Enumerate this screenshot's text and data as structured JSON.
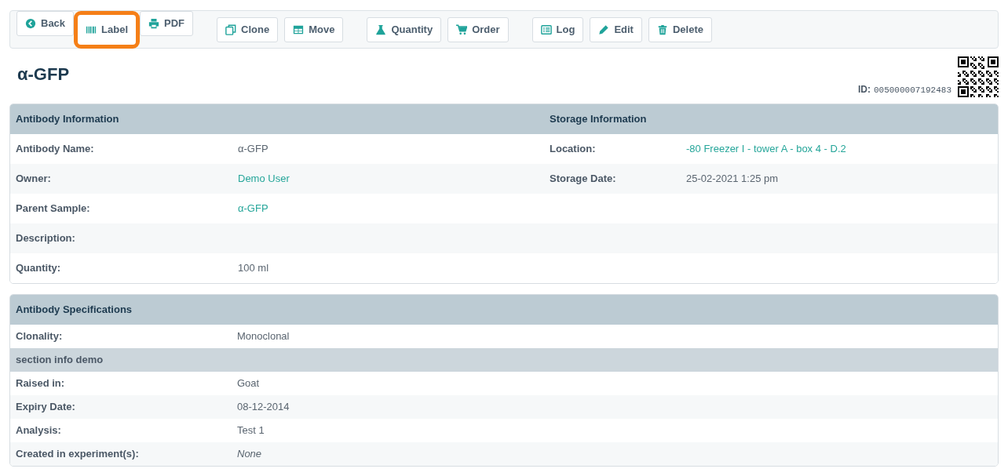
{
  "toolbar": [
    [
      {
        "label": "Back",
        "highlighted": false
      },
      {
        "label": "Label",
        "highlighted": true
      },
      {
        "label": "PDF",
        "highlighted": false
      }
    ],
    [
      {
        "label": "Clone",
        "highlighted": false
      },
      {
        "label": "Move",
        "highlighted": false
      }
    ],
    [
      {
        "label": "Quantity",
        "highlighted": false
      },
      {
        "label": "Order",
        "highlighted": false
      }
    ],
    [
      {
        "label": "Log",
        "highlighted": false
      },
      {
        "label": "Edit",
        "highlighted": false
      },
      {
        "label": "Delete",
        "highlighted": false
      }
    ]
  ],
  "title": "α-GFP",
  "id": {
    "label": "ID:",
    "value": "005000007192483"
  },
  "antibody_information": {
    "title": "Antibody Information",
    "rows": [
      {
        "label": "Antibody Name:",
        "value": "α-GFP",
        "kind": "text"
      },
      {
        "label": "Owner:",
        "value": "Demo User",
        "kind": "link"
      },
      {
        "label": "Parent Sample:",
        "value": "α-GFP",
        "kind": "link"
      },
      {
        "label": "Description:",
        "kind": "text"
      },
      {
        "label": "Quantity:",
        "value": "100 ml",
        "kind": "text"
      }
    ]
  },
  "storage_information": {
    "title": "Storage Information",
    "rows": [
      {
        "label": "Location:",
        "value": "-80 Freezer I - tower A - box 4 - D.2",
        "kind": "link"
      },
      {
        "label": "Storage Date:",
        "value": "25-02-2021 1:25 pm",
        "kind": "text"
      }
    ]
  },
  "antibody_specifications": {
    "title": "Antibody Specifications",
    "rows": [
      {
        "kind": "row",
        "label": "Clonality:",
        "value": "Monoclonal"
      },
      {
        "kind": "section",
        "label": "section info demo"
      },
      {
        "kind": "row",
        "label": "Raised in:",
        "value": "Goat"
      },
      {
        "kind": "row",
        "label": "Expiry Date:",
        "value": "08-12-2014"
      },
      {
        "kind": "row",
        "label": "Analysis:",
        "value": "Test 1"
      },
      {
        "kind": "italic",
        "label": "Created in experiment(s):",
        "value": "None"
      }
    ]
  }
}
